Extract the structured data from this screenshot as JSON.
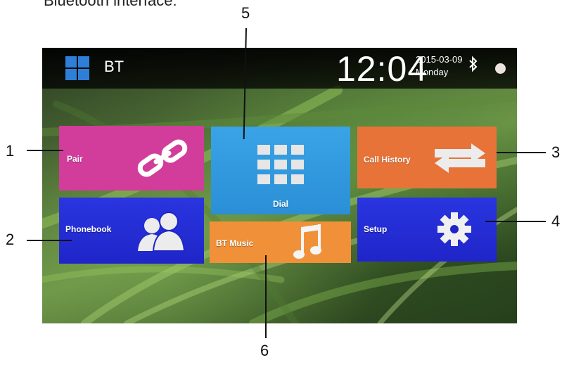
{
  "caption": "Bluetooth interface:",
  "callouts": [
    "1",
    "2",
    "3",
    "4",
    "5",
    "6"
  ],
  "header": {
    "title": "BT",
    "time": "12:04",
    "date": "2015-03-09",
    "weekday": "Monday",
    "icons": [
      "windows-grid-icon",
      "bluetooth-icon",
      "status-dot"
    ]
  },
  "tiles": {
    "pair": {
      "label": "Pair",
      "icon": "link-icon",
      "color": "#d23c9a"
    },
    "dial": {
      "label": "Dial",
      "icon": "keypad-icon",
      "color": "#2b8fd6"
    },
    "call_history": {
      "label": "Call History",
      "icon": "swap-arrows-icon",
      "color": "#e87338"
    },
    "phonebook": {
      "label": "Phonebook",
      "icon": "contacts-icon",
      "color": "#1f25c8"
    },
    "bt_music": {
      "label": "BT Music",
      "icon": "music-note-icon",
      "color": "#f0913a"
    },
    "setup": {
      "label": "Setup",
      "icon": "gear-icon",
      "color": "#1f25c8"
    }
  }
}
